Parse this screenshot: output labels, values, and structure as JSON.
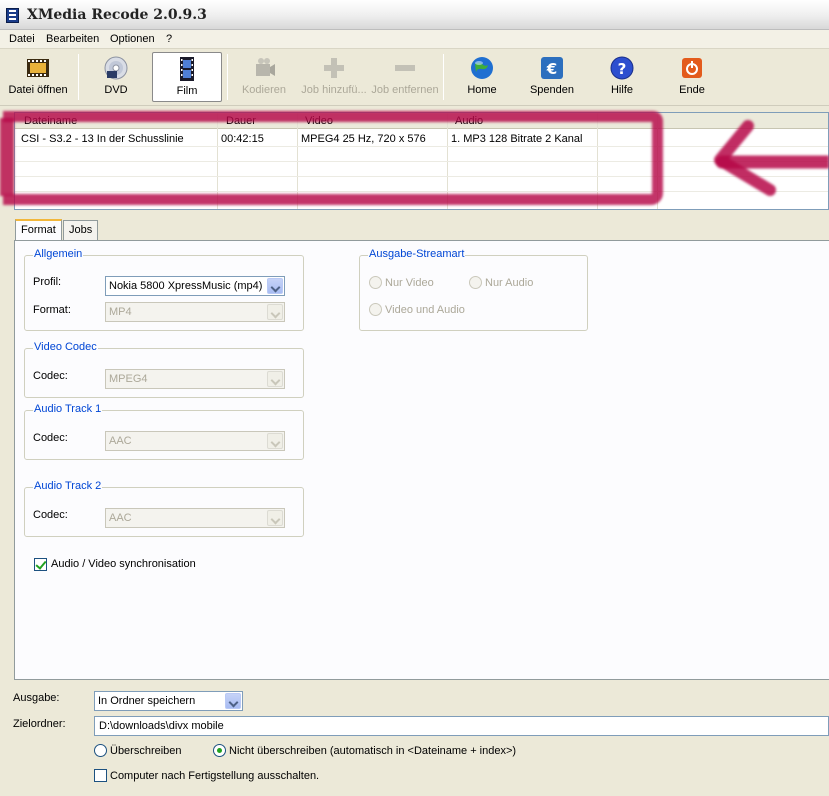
{
  "window": {
    "title": "XMedia Recode 2.0.9.3"
  },
  "menu": [
    "Datei",
    "Bearbeiten",
    "Optionen",
    "?"
  ],
  "toolbar": {
    "open": "Datei öffnen",
    "dvd": "DVD",
    "film": "Film",
    "encode": "Kodieren",
    "add_job": "Job hinzufü...",
    "remove_job": "Job entfernen",
    "home": "Home",
    "donate": "Spenden",
    "help": "Hilfe",
    "exit": "Ende"
  },
  "file_list": {
    "columns": [
      "Dateiname",
      "Dauer",
      "Video",
      "Audio"
    ],
    "rows": [
      {
        "filename": "CSI - S3.2 - 13 In der Schusslinie",
        "duration": "00:42:15",
        "video": "MPEG4 25 Hz, 720 x 576",
        "audio": "1. MP3 128 Bitrate 2 Kanal"
      }
    ]
  },
  "tabs": [
    "Format",
    "Jobs"
  ],
  "format": {
    "general": {
      "title": "Allgemein",
      "profile_label": "Profil:",
      "profile_value": "Nokia 5800 XpressMusic (mp4)",
      "format_label": "Format:",
      "format_value": "MP4"
    },
    "video_codec": {
      "title": "Video Codec",
      "codec_label": "Codec:",
      "codec_value": "MPEG4"
    },
    "audio_track_1": {
      "title": "Audio Track 1",
      "codec_label": "Codec:",
      "codec_value": "AAC"
    },
    "audio_track_2": {
      "title": "Audio Track 2",
      "codec_label": "Codec:",
      "codec_value": "AAC"
    },
    "stream_type": {
      "title": "Ausgabe-Streamart",
      "video_only": "Nur Video",
      "audio_only": "Nur Audio",
      "video_audio": "Video und Audio"
    },
    "av_sync_label": "Audio / Video synchronisation",
    "av_sync_checked": true
  },
  "output": {
    "output_label": "Ausgabe:",
    "output_value": "In Ordner speichern",
    "folder_label": "Zielordner:",
    "folder_value": "D:\\downloads\\divx mobile",
    "overwrite": "Überschreiben",
    "no_overwrite": "Nicht überschreiben (automatisch in <Dateiname + index>)",
    "no_overwrite_selected": true,
    "shutdown_label": "Computer nach Fertigstellung ausschalten.",
    "shutdown_checked": false
  },
  "colors": {
    "annotation": "#b60848",
    "group_title": "#0046d5",
    "tab_highlight": "#f2b73b"
  }
}
